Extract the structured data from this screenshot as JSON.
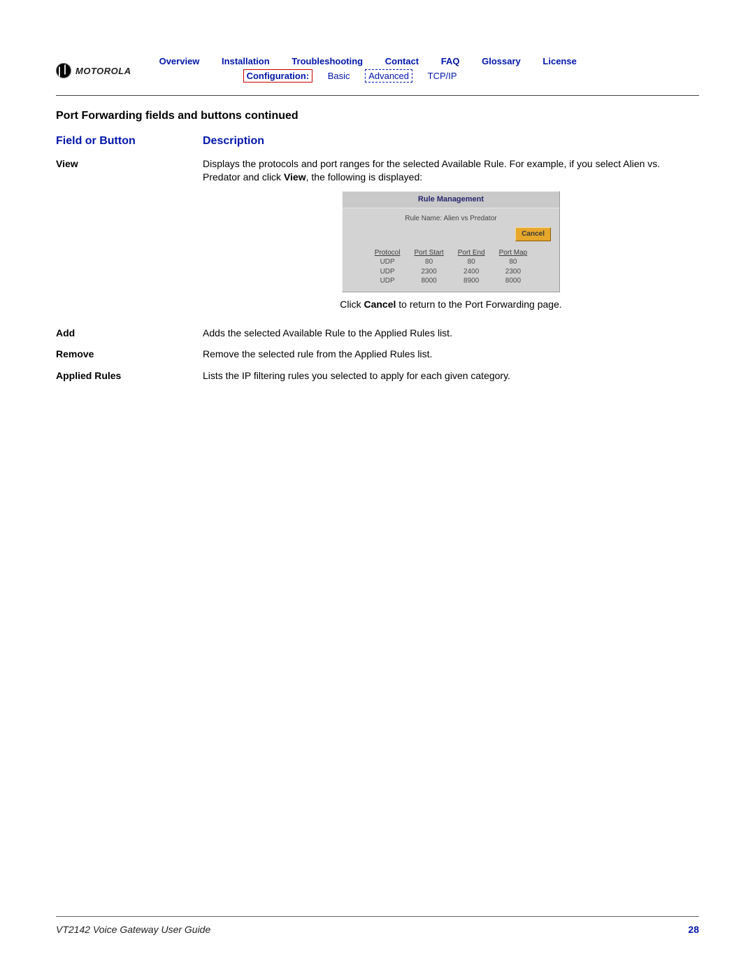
{
  "brand": "MOTOROLA",
  "nav": {
    "top": [
      "Overview",
      "Installation",
      "Troubleshooting",
      "Contact",
      "FAQ",
      "Glossary",
      "License"
    ],
    "config_label": "Configuration:",
    "sub": [
      "Basic",
      "Advanced",
      "TCP/IP"
    ]
  },
  "section_title": "Port Forwarding fields and buttons continued",
  "columns": {
    "field": "Field or Button",
    "desc": "Description"
  },
  "rows": {
    "view": {
      "label": "View",
      "desc_pre": "Displays the protocols and port ranges for the selected Available Rule. For example, if you select Alien vs. Predator and click ",
      "desc_bold": "View",
      "desc_post": ", the following is displayed:",
      "caption_pre": "Click ",
      "caption_bold": "Cancel",
      "caption_post": " to return to the Port Forwarding page."
    },
    "add": {
      "label": "Add",
      "desc": "Adds the selected Available Rule to the Applied Rules list."
    },
    "remove": {
      "label": "Remove",
      "desc": "Remove the selected rule from the Applied Rules list."
    },
    "applied": {
      "label": "Applied Rules",
      "desc": "Lists the IP filtering rules you selected to apply for each given category."
    }
  },
  "rm": {
    "title": "Rule Management",
    "rule_name_label": "Rule Name:",
    "rule_name_value": "Alien vs Predator",
    "cancel": "Cancel",
    "headers": [
      "Protocol",
      "Port Start",
      "Port End",
      "Port Map"
    ],
    "data": [
      [
        "UDP",
        "80",
        "80",
        "80"
      ],
      [
        "UDP",
        "2300",
        "2400",
        "2300"
      ],
      [
        "UDP",
        "8000",
        "8900",
        "8000"
      ]
    ]
  },
  "footer": {
    "doc": "VT2142 Voice Gateway User Guide",
    "page": "28"
  }
}
